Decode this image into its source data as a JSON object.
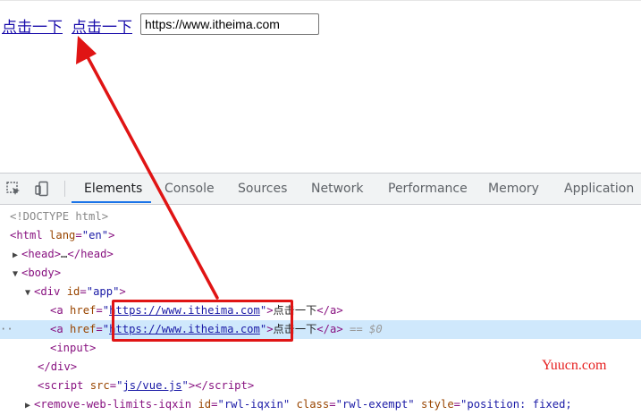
{
  "page": {
    "link1_text": "点击一下",
    "link2_text": "点击一下",
    "input_value": "https://www.itheima.com"
  },
  "devtools": {
    "tabs": [
      "Elements",
      "Console",
      "Sources",
      "Network",
      "Performance",
      "Memory",
      "Application"
    ],
    "active_tab": "Elements",
    "dom": {
      "doctype": "<!DOCTYPE html>",
      "html_open": "html",
      "lang_attr": "lang",
      "lang_val": "\"en\"",
      "head": "head",
      "head_ellipsis": "…",
      "body": "body",
      "div": "div",
      "id_attr": "id",
      "id_val": "\"app\"",
      "a": "a",
      "href_attr": "href",
      "href_url": "https://www.itheima.com",
      "link_text": "点击一下",
      "selected_marker": "== $0",
      "input": "input",
      "script": "script",
      "src_attr": "src",
      "src_val": "js/vue.js",
      "rwl_tag": "remove-web-limits-iqxin",
      "rwl_id_val": "\"rwl-iqxin\"",
      "class_attr": "class",
      "rwl_class_val": "\"rwl-exempt\"",
      "style_attr": "style",
      "rwl_style_val": "\"position: fixed;"
    }
  },
  "watermark": "Yuucn.com",
  "colors": {
    "annotation_red": "#e01414",
    "tab_active_blue": "#1a73e8",
    "selected_row": "#cfe8fc"
  }
}
